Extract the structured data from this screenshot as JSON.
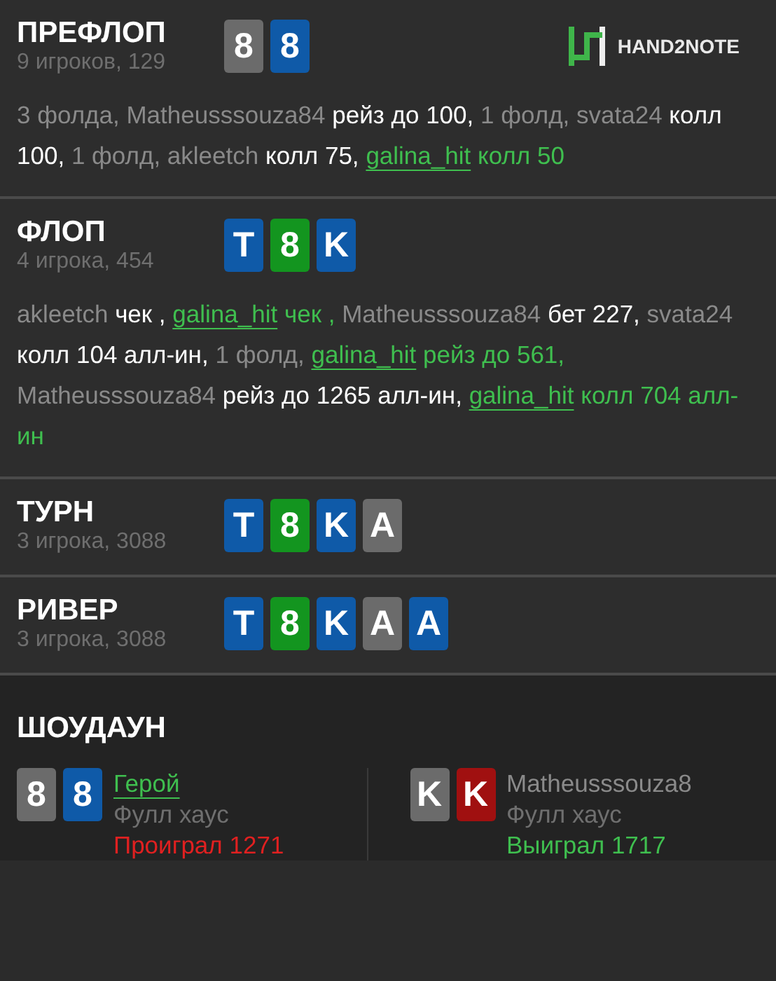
{
  "streets": [
    {
      "title": "ПРЕФЛОП",
      "subtitle": "9 игроков, 129",
      "cards": [
        {
          "rank": "8",
          "color": "#6b6b6b"
        },
        {
          "rank": "8",
          "color": "#0f5aa8"
        }
      ],
      "logo": {
        "text": "HAND2NOTE"
      },
      "log": [
        {
          "kind": "muted",
          "text": "3 фолда, Matheusssouza84"
        },
        {
          "kind": "action",
          "text": "рейз до 100,"
        },
        {
          "kind": "muted",
          "text": "1 фолд, svata24"
        },
        {
          "kind": "action",
          "text": "колл 100,"
        },
        {
          "kind": "muted",
          "text": "1 фолд, akleetch"
        },
        {
          "kind": "action",
          "text": "колл 75,"
        },
        {
          "kind": "hero_name",
          "text": "galina_hit"
        },
        {
          "kind": "hero_action",
          "text": "колл 50"
        }
      ]
    },
    {
      "title": "ФЛОП",
      "subtitle": "4 игрока, 454",
      "cards": [
        {
          "rank": "T",
          "color": "#0f5aa8"
        },
        {
          "rank": "8",
          "color": "#13951f"
        },
        {
          "rank": "K",
          "color": "#0f5aa8"
        }
      ],
      "log": [
        {
          "kind": "muted",
          "text": "akleetch"
        },
        {
          "kind": "action",
          "text": "чек ,"
        },
        {
          "kind": "hero_name",
          "text": "galina_hit"
        },
        {
          "kind": "hero_action",
          "text": "чек ,"
        },
        {
          "kind": "muted",
          "text": "Matheusssouza84"
        },
        {
          "kind": "action",
          "text": "бет 227,"
        },
        {
          "kind": "muted",
          "text": "svata24"
        },
        {
          "kind": "action",
          "text": "колл 104 алл-ин,"
        },
        {
          "kind": "muted",
          "text": "1 фолд,"
        },
        {
          "kind": "hero_name",
          "text": "galina_hit"
        },
        {
          "kind": "hero_action",
          "text": "рейз до 561,"
        },
        {
          "kind": "muted",
          "text": "Matheusssouza84"
        },
        {
          "kind": "action",
          "text": "рейз до 1265 алл-ин,"
        },
        {
          "kind": "hero_name",
          "text": "galina_hit"
        },
        {
          "kind": "hero_action",
          "text": "колл 704 алл-ин"
        }
      ]
    },
    {
      "title": "ТУРН",
      "subtitle": "3 игрока, 3088",
      "cards": [
        {
          "rank": "T",
          "color": "#0f5aa8"
        },
        {
          "rank": "8",
          "color": "#13951f"
        },
        {
          "rank": "K",
          "color": "#0f5aa8"
        },
        {
          "rank": "A",
          "color": "#6b6b6b"
        }
      ]
    },
    {
      "title": "РИВЕР",
      "subtitle": "3 игрока, 3088",
      "cards": [
        {
          "rank": "T",
          "color": "#0f5aa8"
        },
        {
          "rank": "8",
          "color": "#13951f"
        },
        {
          "rank": "K",
          "color": "#0f5aa8"
        },
        {
          "rank": "A",
          "color": "#6b6b6b"
        },
        {
          "rank": "A",
          "color": "#0f5aa8"
        }
      ]
    }
  ],
  "showdown": {
    "title": "ШОУДАУН",
    "players": [
      {
        "name": "Герой",
        "hero": true,
        "hand": "Фулл хаус",
        "result": "Проиграл 1271",
        "won": false,
        "cards": [
          {
            "rank": "8",
            "color": "#6b6b6b"
          },
          {
            "rank": "8",
            "color": "#0f5aa8"
          }
        ]
      },
      {
        "name": "Matheusssouza8",
        "hero": false,
        "hand": "Фулл хаус",
        "result": "Выиграл 1717",
        "won": true,
        "cards": [
          {
            "rank": "K",
            "color": "#6b6b6b"
          },
          {
            "rank": "K",
            "color": "#a01010"
          }
        ]
      }
    ]
  }
}
